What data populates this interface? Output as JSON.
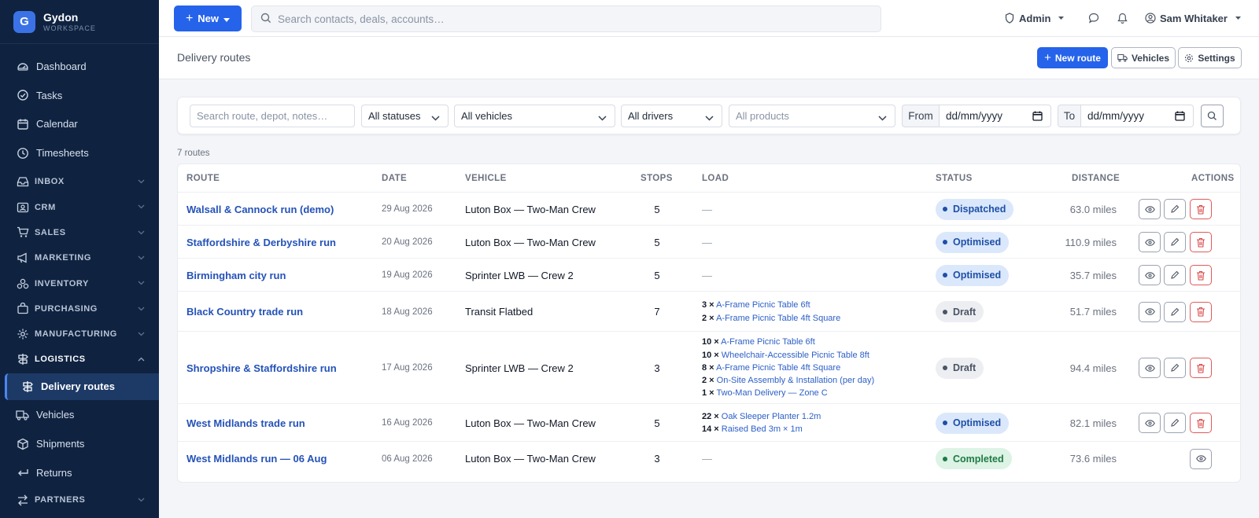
{
  "brand": {
    "initial": "G",
    "name": "Gydon",
    "sub": "WORKSPACE"
  },
  "nav": {
    "dashboard": "Dashboard",
    "tasks": "Tasks",
    "calendar": "Calendar",
    "timesheets": "Timesheets",
    "inbox": "INBOX",
    "crm": "CRM",
    "sales": "SALES",
    "marketing": "MARKETING",
    "inventory": "INVENTORY",
    "purchasing": "PURCHASING",
    "manufacturing": "MANUFACTURING",
    "logistics": "LOGISTICS",
    "delivery_routes": "Delivery routes",
    "vehicles": "Vehicles",
    "shipments": "Shipments",
    "returns": "Returns",
    "partners": "PARTNERS"
  },
  "topbar": {
    "new_label": "New",
    "search_placeholder": "Search contacts, deals, accounts…",
    "admin_label": "Admin",
    "user_name": "Sam Whitaker"
  },
  "page": {
    "title": "Delivery routes",
    "new_route": "New route",
    "vehicles": "Vehicles",
    "settings": "Settings"
  },
  "filters": {
    "search_placeholder": "Search route, depot, notes…",
    "status": "All statuses",
    "vehicle": "All vehicles",
    "driver": "All drivers",
    "product": "All products",
    "from_label": "From",
    "to_label": "To",
    "date_placeholder": "dd/mm/yyyy"
  },
  "count_text": "7 routes",
  "table": {
    "headers": {
      "route": "ROUTE",
      "date": "DATE",
      "vehicle": "VEHICLE",
      "stops": "STOPS",
      "load": "LOAD",
      "status": "STATUS",
      "distance": "DISTANCE",
      "actions": "ACTIONS"
    },
    "rows": [
      {
        "route": "Walsall & Cannock run (demo)",
        "date": "29 Aug 2026",
        "vehicle": "Luton Box — Two-Man Crew",
        "stops": "5",
        "load_empty": "—",
        "status": "Dispatched",
        "distance": "63.0 miles"
      },
      {
        "route": "Staffordshire & Derbyshire run",
        "date": "20 Aug 2026",
        "vehicle": "Luton Box — Two-Man Crew",
        "stops": "5",
        "load_empty": "—",
        "status": "Optimised",
        "distance": "110.9 miles"
      },
      {
        "route": "Birmingham city run",
        "date": "19 Aug 2026",
        "vehicle": "Sprinter LWB — Crew 2",
        "stops": "5",
        "load_empty": "—",
        "status": "Optimised",
        "distance": "35.7 miles"
      },
      {
        "route": "Black Country trade run",
        "date": "18 Aug 2026",
        "vehicle": "Transit Flatbed",
        "stops": "7",
        "load": [
          {
            "qty": "3 ×",
            "product": "A-Frame Picnic Table 6ft"
          },
          {
            "qty": "2 ×",
            "product": "A-Frame Picnic Table 4ft Square"
          }
        ],
        "status": "Draft",
        "distance": "51.7 miles"
      },
      {
        "route": "Shropshire & Staffordshire run",
        "date": "17 Aug 2026",
        "vehicle": "Sprinter LWB — Crew 2",
        "stops": "3",
        "load": [
          {
            "qty": "10 ×",
            "product": "A-Frame Picnic Table 6ft"
          },
          {
            "qty": "10 ×",
            "product": "Wheelchair-Accessible Picnic Table 8ft"
          },
          {
            "qty": "8 ×",
            "product": "A-Frame Picnic Table 4ft Square"
          },
          {
            "qty": "2 ×",
            "product": "On-Site Assembly & Installation (per day)"
          },
          {
            "qty": "1 ×",
            "product": "Two-Man Delivery — Zone C"
          }
        ],
        "status": "Draft",
        "distance": "94.4 miles"
      },
      {
        "route": "West Midlands trade run",
        "date": "16 Aug 2026",
        "vehicle": "Luton Box — Two-Man Crew",
        "stops": "5",
        "load": [
          {
            "qty": "22 ×",
            "product": "Oak Sleeper Planter 1.2m"
          },
          {
            "qty": "14 ×",
            "product": "Raised Bed 3m × 1m"
          }
        ],
        "status": "Optimised",
        "distance": "82.1 miles"
      },
      {
        "route": "West Midlands run — 06 Aug",
        "date": "06 Aug 2026",
        "vehicle": "Luton Box — Two-Man Crew",
        "stops": "3",
        "load_empty": "—",
        "status": "Completed",
        "distance": "73.6 miles"
      }
    ]
  },
  "colors": {
    "primary": "#2563eb",
    "sidebar_bg": "#0f2341",
    "status_blue_bg": "#dbe8fb",
    "status_blue_text": "#1e4fa8",
    "status_draft_bg": "#eceef2",
    "status_draft_text": "#4b5563",
    "status_green_bg": "#dcf3e5",
    "status_green_text": "#1f7a45",
    "danger": "#e05a5a"
  }
}
